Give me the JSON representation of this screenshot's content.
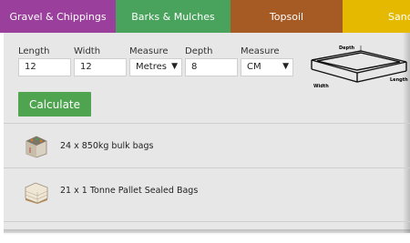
{
  "tabs": [
    {
      "label": "Gravel & Chippings"
    },
    {
      "label": "Barks & Mulches"
    },
    {
      "label": "Topsoil"
    },
    {
      "label": "Sand"
    }
  ],
  "form": {
    "length": {
      "label": "Length",
      "value": "12"
    },
    "width": {
      "label": "Width",
      "value": "12"
    },
    "measure1": {
      "label": "Measure",
      "value": "Metres"
    },
    "depth": {
      "label": "Depth",
      "value": "8"
    },
    "measure2": {
      "label": "Measure",
      "value": "CM"
    }
  },
  "diagram": {
    "depth": "Depth",
    "width": "Width",
    "length": "Length"
  },
  "calculate_label": "Calculate",
  "results": [
    {
      "text": "24 x 850kg bulk bags",
      "icon": "bulk-bag-icon"
    },
    {
      "text": "21 x 1 Tonne Pallet Sealed Bags",
      "icon": "pallet-bags-icon"
    }
  ],
  "colors": {
    "gravel": "#9a3f9c",
    "barks": "#49a35c",
    "topsoil": "#a65a24",
    "sand": "#e4b900",
    "calculate": "#4ea44f"
  }
}
